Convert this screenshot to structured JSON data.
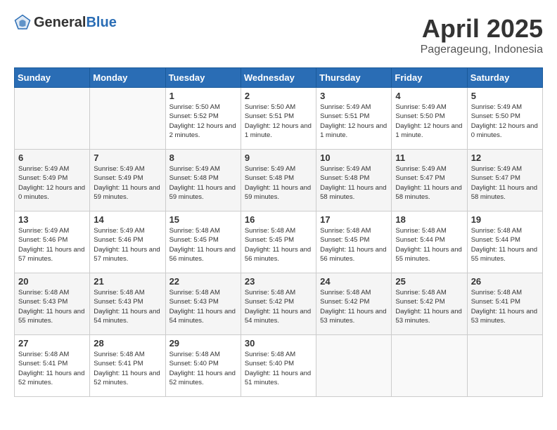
{
  "header": {
    "logo_general": "General",
    "logo_blue": "Blue",
    "title": "April 2025",
    "location": "Pagerageung, Indonesia"
  },
  "weekdays": [
    "Sunday",
    "Monday",
    "Tuesday",
    "Wednesday",
    "Thursday",
    "Friday",
    "Saturday"
  ],
  "weeks": [
    [
      {
        "day": "",
        "info": ""
      },
      {
        "day": "",
        "info": ""
      },
      {
        "day": "1",
        "info": "Sunrise: 5:50 AM\nSunset: 5:52 PM\nDaylight: 12 hours and 2 minutes."
      },
      {
        "day": "2",
        "info": "Sunrise: 5:50 AM\nSunset: 5:51 PM\nDaylight: 12 hours and 1 minute."
      },
      {
        "day": "3",
        "info": "Sunrise: 5:49 AM\nSunset: 5:51 PM\nDaylight: 12 hours and 1 minute."
      },
      {
        "day": "4",
        "info": "Sunrise: 5:49 AM\nSunset: 5:50 PM\nDaylight: 12 hours and 1 minute."
      },
      {
        "day": "5",
        "info": "Sunrise: 5:49 AM\nSunset: 5:50 PM\nDaylight: 12 hours and 0 minutes."
      }
    ],
    [
      {
        "day": "6",
        "info": "Sunrise: 5:49 AM\nSunset: 5:49 PM\nDaylight: 12 hours and 0 minutes."
      },
      {
        "day": "7",
        "info": "Sunrise: 5:49 AM\nSunset: 5:49 PM\nDaylight: 11 hours and 59 minutes."
      },
      {
        "day": "8",
        "info": "Sunrise: 5:49 AM\nSunset: 5:48 PM\nDaylight: 11 hours and 59 minutes."
      },
      {
        "day": "9",
        "info": "Sunrise: 5:49 AM\nSunset: 5:48 PM\nDaylight: 11 hours and 59 minutes."
      },
      {
        "day": "10",
        "info": "Sunrise: 5:49 AM\nSunset: 5:48 PM\nDaylight: 11 hours and 58 minutes."
      },
      {
        "day": "11",
        "info": "Sunrise: 5:49 AM\nSunset: 5:47 PM\nDaylight: 11 hours and 58 minutes."
      },
      {
        "day": "12",
        "info": "Sunrise: 5:49 AM\nSunset: 5:47 PM\nDaylight: 11 hours and 58 minutes."
      }
    ],
    [
      {
        "day": "13",
        "info": "Sunrise: 5:49 AM\nSunset: 5:46 PM\nDaylight: 11 hours and 57 minutes."
      },
      {
        "day": "14",
        "info": "Sunrise: 5:49 AM\nSunset: 5:46 PM\nDaylight: 11 hours and 57 minutes."
      },
      {
        "day": "15",
        "info": "Sunrise: 5:48 AM\nSunset: 5:45 PM\nDaylight: 11 hours and 56 minutes."
      },
      {
        "day": "16",
        "info": "Sunrise: 5:48 AM\nSunset: 5:45 PM\nDaylight: 11 hours and 56 minutes."
      },
      {
        "day": "17",
        "info": "Sunrise: 5:48 AM\nSunset: 5:45 PM\nDaylight: 11 hours and 56 minutes."
      },
      {
        "day": "18",
        "info": "Sunrise: 5:48 AM\nSunset: 5:44 PM\nDaylight: 11 hours and 55 minutes."
      },
      {
        "day": "19",
        "info": "Sunrise: 5:48 AM\nSunset: 5:44 PM\nDaylight: 11 hours and 55 minutes."
      }
    ],
    [
      {
        "day": "20",
        "info": "Sunrise: 5:48 AM\nSunset: 5:43 PM\nDaylight: 11 hours and 55 minutes."
      },
      {
        "day": "21",
        "info": "Sunrise: 5:48 AM\nSunset: 5:43 PM\nDaylight: 11 hours and 54 minutes."
      },
      {
        "day": "22",
        "info": "Sunrise: 5:48 AM\nSunset: 5:43 PM\nDaylight: 11 hours and 54 minutes."
      },
      {
        "day": "23",
        "info": "Sunrise: 5:48 AM\nSunset: 5:42 PM\nDaylight: 11 hours and 54 minutes."
      },
      {
        "day": "24",
        "info": "Sunrise: 5:48 AM\nSunset: 5:42 PM\nDaylight: 11 hours and 53 minutes."
      },
      {
        "day": "25",
        "info": "Sunrise: 5:48 AM\nSunset: 5:42 PM\nDaylight: 11 hours and 53 minutes."
      },
      {
        "day": "26",
        "info": "Sunrise: 5:48 AM\nSunset: 5:41 PM\nDaylight: 11 hours and 53 minutes."
      }
    ],
    [
      {
        "day": "27",
        "info": "Sunrise: 5:48 AM\nSunset: 5:41 PM\nDaylight: 11 hours and 52 minutes."
      },
      {
        "day": "28",
        "info": "Sunrise: 5:48 AM\nSunset: 5:41 PM\nDaylight: 11 hours and 52 minutes."
      },
      {
        "day": "29",
        "info": "Sunrise: 5:48 AM\nSunset: 5:40 PM\nDaylight: 11 hours and 52 minutes."
      },
      {
        "day": "30",
        "info": "Sunrise: 5:48 AM\nSunset: 5:40 PM\nDaylight: 11 hours and 51 minutes."
      },
      {
        "day": "",
        "info": ""
      },
      {
        "day": "",
        "info": ""
      },
      {
        "day": "",
        "info": ""
      }
    ]
  ]
}
